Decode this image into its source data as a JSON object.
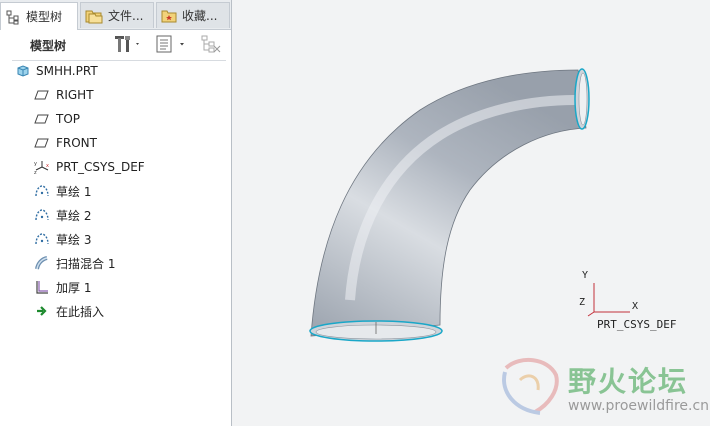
{
  "tabs": [
    {
      "label": "模型树",
      "icon": "tree-icon"
    },
    {
      "label": "文件...",
      "icon": "folders-icon"
    },
    {
      "label": "收藏...",
      "icon": "star-folder-icon"
    }
  ],
  "panel": {
    "title": "模型树"
  },
  "tree": {
    "root": "SMHH.PRT",
    "items": [
      {
        "label": "RIGHT",
        "icon": "datum-plane-icon"
      },
      {
        "label": "TOP",
        "icon": "datum-plane-icon"
      },
      {
        "label": "FRONT",
        "icon": "datum-plane-icon"
      },
      {
        "label": "PRT_CSYS_DEF",
        "icon": "csys-icon"
      },
      {
        "label": "草绘 1",
        "icon": "sketch-icon"
      },
      {
        "label": "草绘 2",
        "icon": "sketch-icon"
      },
      {
        "label": "草绘 3",
        "icon": "sketch-icon"
      },
      {
        "label": "扫描混合 1",
        "icon": "swept-blend-icon"
      },
      {
        "label": "加厚 1",
        "icon": "thicken-icon"
      },
      {
        "label": "在此插入",
        "icon": "insert-here-arrow-icon"
      }
    ]
  },
  "viewport": {
    "csys_label": "PRT_CSYS_DEF",
    "axis_y": "Y",
    "axis_z": "Z",
    "axis_x": "X"
  },
  "watermark": {
    "title": "野火论坛",
    "url": "www.proewildfire.cn"
  },
  "colors": {
    "pipe": "#a9b0b9",
    "edge_highlight": "#1aa7c8",
    "watermark_green": "#7ec08a"
  }
}
